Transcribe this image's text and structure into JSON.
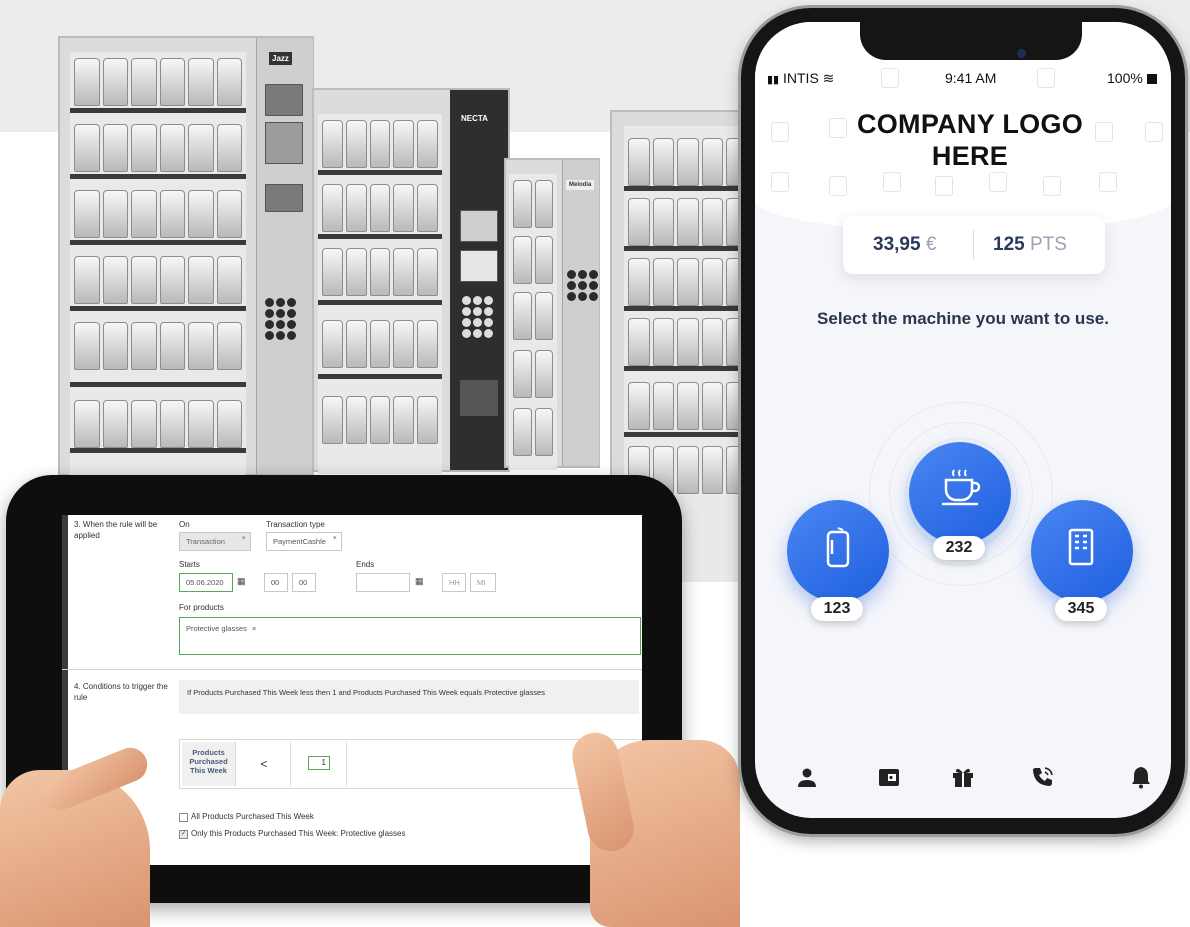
{
  "tablet": {
    "section3_label": "3. When the rule will be applied",
    "on_label": "On",
    "on_value": "Transaction",
    "transaction_type_label": "Transaction type",
    "transaction_type_value": "PaymentCashle",
    "starts_label": "Starts",
    "starts_date": "05.06.2020",
    "starts_hour": "00",
    "starts_minute": "00",
    "ends_label": "Ends",
    "ends_date": "",
    "ends_hour": "HH",
    "ends_minute": "MI",
    "for_products_label": "For products",
    "product_tag": "Protective glasses",
    "product_tag_remove": "×",
    "section4_label": "4. Conditions to trigger the rule",
    "condition_text": "If Products Purchased This Week less then 1 and Products Purchased This Week equals Protective glasses",
    "condition_field": "Products Purchased This Week",
    "condition_operator": "<",
    "condition_value": "1",
    "check1_label": "All Products Purchased This Week",
    "check1_checked": false,
    "check2_label": "Only this Products Purchased This Week: Protective glasses",
    "check2_checked": true
  },
  "phone": {
    "carrier": "INTIS",
    "time": "9:41 AM",
    "battery": "100%",
    "logo_text": "COMPANY LOGO HERE",
    "balance_amount": "33,95",
    "balance_currency": "€",
    "points_amount": "125",
    "points_unit": "PTS",
    "prompt": "Select the machine you want to use.",
    "machines": [
      {
        "icon": "can-icon",
        "number": "123"
      },
      {
        "icon": "coffee-cup-icon",
        "number": "232"
      },
      {
        "icon": "snack-machine-icon",
        "number": "345"
      }
    ],
    "nav_icons": [
      "user-icon",
      "wallet-icon",
      "gift-icon",
      "phone-call-icon",
      "bell-icon"
    ],
    "accent_color": "#2f6ef0"
  },
  "vending_brands": {
    "brand1": "Jazz",
    "brand2": "NECTA",
    "brand3": "Melodia"
  }
}
